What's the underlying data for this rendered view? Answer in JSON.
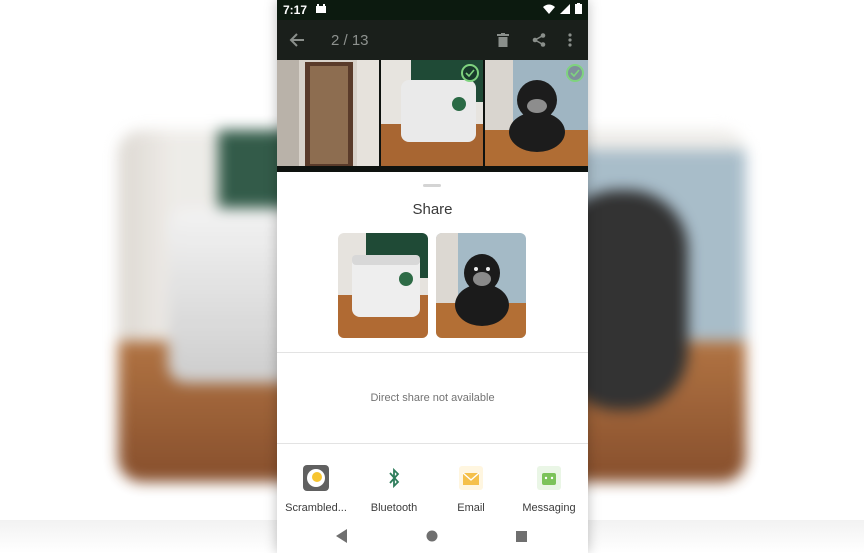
{
  "status_bar": {
    "time": "7:17",
    "icons": [
      "notification-icon",
      "wifi-icon",
      "signal-icon",
      "battery-icon"
    ]
  },
  "toolbar": {
    "counter": "2 / 13",
    "icons": [
      "back-arrow-icon",
      "delete-icon",
      "share-icon",
      "more-vert-icon"
    ]
  },
  "gallery": {
    "selected": [
      false,
      true,
      true
    ]
  },
  "share_sheet": {
    "title": "Share",
    "direct_share_message": "Direct share not available",
    "apps": [
      {
        "label": "Scrambled...",
        "icon": "scrambled-exif-icon"
      },
      {
        "label": "Bluetooth",
        "icon": "bluetooth-icon"
      },
      {
        "label": "Email",
        "icon": "email-icon"
      },
      {
        "label": "Messaging",
        "icon": "messaging-icon"
      }
    ]
  },
  "nav_bar": {
    "icons": [
      "nav-back-icon",
      "nav-home-icon",
      "nav-recents-icon"
    ]
  },
  "colors": {
    "status_bar": "#0c1a0f",
    "toolbar": "#1a1f1b",
    "check": "#7fd37f",
    "bluetooth": "#2e7d5b"
  }
}
